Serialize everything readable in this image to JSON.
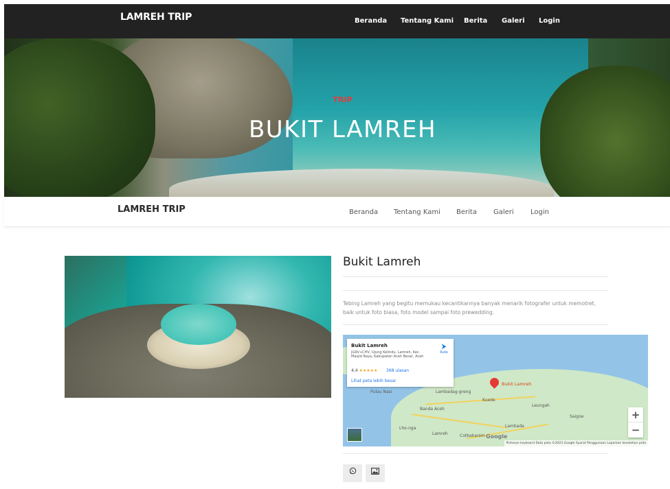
{
  "top_nav": {
    "brand": "LAMREH TRIP",
    "items": [
      "Beranda",
      "Tentang Kami",
      "Berita",
      "Galeri",
      "Login"
    ]
  },
  "hero": {
    "subtitle": "TRIP",
    "title": "BUKIT LAMREH"
  },
  "sticky_nav": {
    "brand": "LAMREH TRIP",
    "items": [
      "Beranda",
      "Tentang Kami",
      "Berita",
      "Galeri",
      "Login"
    ]
  },
  "detail": {
    "title": "Bukit Lamreh",
    "description": "Tebing Lamreh yang begitu memukau kecantikannya banyak menarik fotografer untuk memotret, baik untuk foto biasa, foto model sampai foto prewedding."
  },
  "map": {
    "place_name": "Bukit Lamreh",
    "address": "JG9V+CHV, Ujung Kelindu, Lamreh, Kec. Masjid Raya, Kabupaten Aceh Besar, Aceh",
    "rating": "4,4",
    "stars": "★★★★★",
    "reviews": "368 ulasan",
    "larger_map": "Lihat peta lebih besar",
    "route": "Rute",
    "pin_label": "Bukit Lamreh",
    "places": [
      "Pulau Nasi",
      "Lambadag-greng",
      "Kuede",
      "Banda Aceh",
      "Leungah",
      "Saigoe",
      "Lho-nga",
      "Lamreh",
      "Lambada",
      "Cotbakarem"
    ],
    "zoom_in": "+",
    "zoom_out": "−",
    "google": "Google",
    "footer": "Pintasan keyboard   Data peta ©2023 Google   Syarat Penggunaan   Laporkan kesalahan peta"
  },
  "share": {
    "whatsapp_icon": "whatsapp-icon",
    "gallery_icon": "image-icon"
  }
}
